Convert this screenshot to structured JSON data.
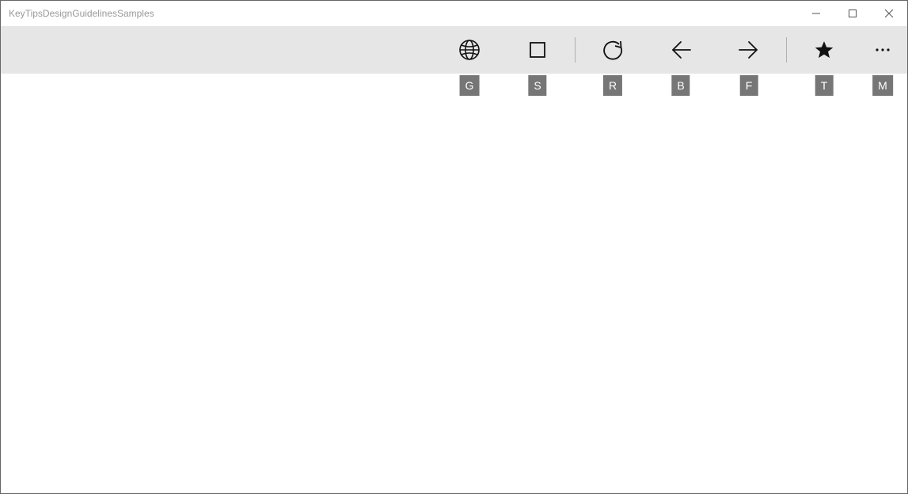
{
  "window": {
    "title": "KeyTipsDesignGuidelinesSamples"
  },
  "toolbar": {
    "items": [
      {
        "name": "globe-button",
        "icon": "globe-icon",
        "keytip": "G"
      },
      {
        "name": "stop-button",
        "icon": "square-icon",
        "keytip": "S"
      },
      {
        "separator": true
      },
      {
        "name": "refresh-button",
        "icon": "refresh-icon",
        "keytip": "R"
      },
      {
        "name": "back-button",
        "icon": "back-icon",
        "keytip": "B"
      },
      {
        "name": "forward-button",
        "icon": "forward-icon",
        "keytip": "F"
      },
      {
        "separator": true
      },
      {
        "name": "favorite-button",
        "icon": "star-icon",
        "keytip": "T"
      },
      {
        "name": "more-button",
        "icon": "more-icon",
        "keytip": "M"
      }
    ]
  }
}
